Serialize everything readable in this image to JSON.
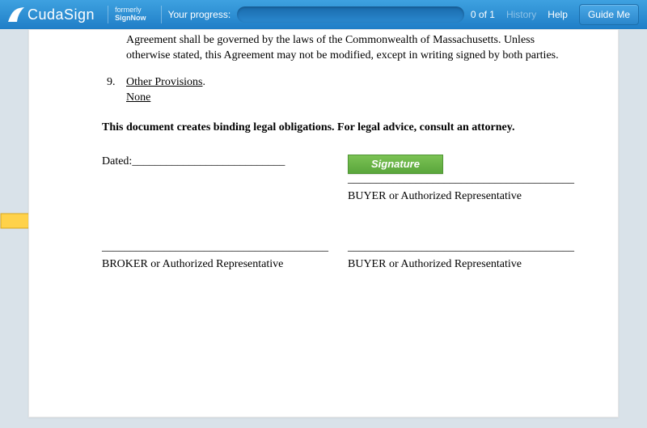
{
  "header": {
    "brand_prefix": "Cuda",
    "brand_suffix": "Sign",
    "formerly_word": "formerly",
    "formerly_name": "SignNow",
    "progress_label": "Your progress:",
    "progress_count": "0 of 1",
    "history": "History",
    "help": "Help",
    "guide": "Guide Me"
  },
  "doc": {
    "para_tail": "Agreement shall be governed by the laws of the Commonwealth of Massachusetts.  Unless otherwise stated, this Agreement may not be modified, except in writing signed by both parties.",
    "item9_num": "9.",
    "item9_title": "Other Provisions",
    "item9_body": "None",
    "notice": "This document creates binding legal obligations.  For legal advice, consult an attorney.",
    "dated_label": "Dated:",
    "dated_line": " ___________________________",
    "sig_line": "________________________________________",
    "signature_btn": "Signature",
    "buyer_label": "BUYER or Authorized Representative",
    "broker_label": "BROKER or Authorized Representative"
  }
}
